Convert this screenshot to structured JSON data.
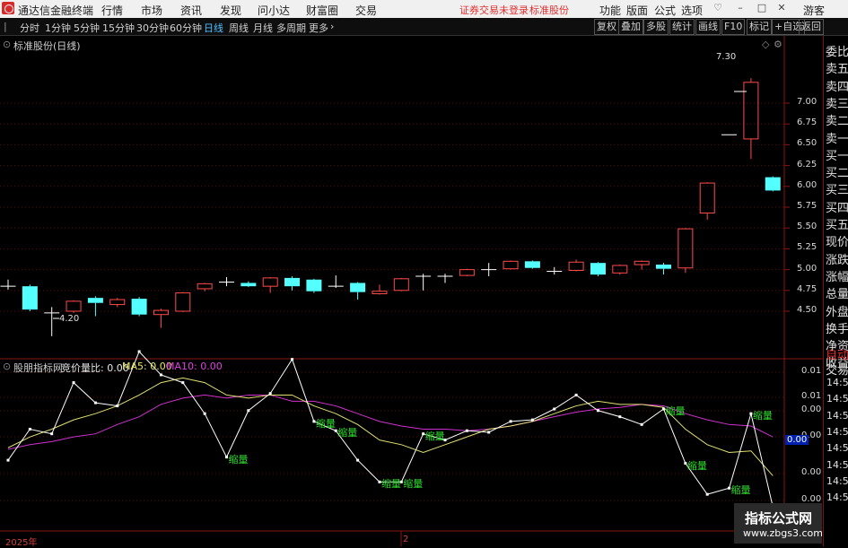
{
  "titlebar": {
    "app_name": "通达信金融终端",
    "menus": [
      "行情",
      "市场",
      "资讯",
      "发现",
      "问小达",
      "财富圈",
      "交易"
    ],
    "status_red": "证券交易未登录",
    "stock_red": "标准股份",
    "right_menus": [
      "功能",
      "版面",
      "公式",
      "选项"
    ],
    "guest": "游客"
  },
  "toolbar": {
    "periods": [
      "分时",
      "1分钟",
      "5分钟",
      "15分钟",
      "30分钟",
      "60分钟",
      "日线",
      "周线",
      "月线",
      "多周期",
      "更多"
    ],
    "selected": "日线",
    "buttons": [
      "复权",
      "叠加",
      "多股",
      "统计",
      "画线",
      "F10",
      "标记",
      "+自选",
      "返回"
    ]
  },
  "main_chart": {
    "title": "标准股份(日线)",
    "yticks": [
      "7.00",
      "6.75",
      "6.50",
      "6.25",
      "6.00",
      "5.75",
      "5.50",
      "5.25",
      "5.00",
      "4.75",
      "4.50"
    ],
    "high_label": "7.30",
    "low_label": "4.20"
  },
  "sub_chart": {
    "name": "股朋指标网",
    "indicator": "竞价量比: 0.00",
    "ma5": "MA5: 0.00",
    "ma10": "MA10: 0.00",
    "yticks": [
      "0.01",
      "0.01",
      "0.00",
      "0.00",
      "0.00",
      "0.00"
    ],
    "current": "0.00",
    "tag": "缩量"
  },
  "xaxis": {
    "year": "2025年",
    "mark": "2"
  },
  "right_panel": {
    "items": [
      "委比",
      "卖五",
      "卖四",
      "卖三",
      "卖二",
      "卖一",
      "买一",
      "买二",
      "买三",
      "买四",
      "买五",
      "现价",
      "涨跌",
      "涨幅",
      "总量",
      "外盘",
      "换手",
      "净资",
      "收益"
    ],
    "auto": "自动",
    "trade": "交易",
    "times": [
      "14:56",
      "14:56",
      "14:56",
      "14:56",
      "14:56",
      "14:56",
      "14:56",
      "14:56"
    ]
  },
  "watermark": {
    "line1": "指标公式网",
    "line2": "www.zbgs3.com"
  },
  "chart_data": {
    "type": "candlestick",
    "candles": [
      {
        "o": 4.8,
        "c": 4.8,
        "h": 4.88,
        "l": 4.76
      },
      {
        "o": 4.8,
        "c": 4.52,
        "h": 4.82,
        "l": 4.5
      },
      {
        "o": 4.48,
        "c": 4.48,
        "h": 4.55,
        "l": 4.2
      },
      {
        "o": 4.5,
        "c": 4.62,
        "h": 4.63,
        "l": 4.48
      },
      {
        "o": 4.66,
        "c": 4.6,
        "h": 4.68,
        "l": 4.44
      },
      {
        "o": 4.58,
        "c": 4.64,
        "h": 4.66,
        "l": 4.55
      },
      {
        "o": 4.65,
        "c": 4.46,
        "h": 4.67,
        "l": 4.44
      },
      {
        "o": 4.46,
        "c": 4.51,
        "h": 4.53,
        "l": 4.3
      },
      {
        "o": 4.5,
        "c": 4.72,
        "h": 4.73,
        "l": 4.49
      },
      {
        "o": 4.77,
        "c": 4.83,
        "h": 4.84,
        "l": 4.74
      },
      {
        "o": 4.85,
        "c": 4.85,
        "h": 4.91,
        "l": 4.8
      },
      {
        "o": 4.84,
        "c": 4.8,
        "h": 4.86,
        "l": 4.79
      },
      {
        "o": 4.8,
        "c": 4.9,
        "h": 4.91,
        "l": 4.72
      },
      {
        "o": 4.9,
        "c": 4.8,
        "h": 4.92,
        "l": 4.75
      },
      {
        "o": 4.88,
        "c": 4.74,
        "h": 4.89,
        "l": 4.72
      },
      {
        "o": 4.8,
        "c": 4.8,
        "h": 4.93,
        "l": 4.78
      },
      {
        "o": 4.84,
        "c": 4.73,
        "h": 4.85,
        "l": 4.64
      },
      {
        "o": 4.71,
        "c": 4.74,
        "h": 4.82,
        "l": 4.7
      },
      {
        "o": 4.75,
        "c": 4.89,
        "h": 4.9,
        "l": 4.74
      },
      {
        "o": 4.92,
        "c": 4.92,
        "h": 4.95,
        "l": 4.75
      },
      {
        "o": 4.92,
        "c": 4.92,
        "h": 4.95,
        "l": 4.84
      },
      {
        "o": 4.93,
        "c": 5.0,
        "h": 5.01,
        "l": 4.92
      },
      {
        "o": 5.0,
        "c": 5.0,
        "h": 5.08,
        "l": 4.92
      },
      {
        "o": 5.01,
        "c": 5.1,
        "h": 5.11,
        "l": 5.0
      },
      {
        "o": 5.1,
        "c": 5.02,
        "h": 5.11,
        "l": 5.01
      },
      {
        "o": 4.98,
        "c": 4.98,
        "h": 5.03,
        "l": 4.94
      },
      {
        "o": 4.99,
        "c": 5.09,
        "h": 5.12,
        "l": 4.98
      },
      {
        "o": 5.08,
        "c": 4.94,
        "h": 5.09,
        "l": 4.92
      },
      {
        "o": 4.96,
        "c": 5.05,
        "h": 5.06,
        "l": 4.94
      },
      {
        "o": 5.06,
        "c": 5.1,
        "h": 5.11,
        "l": 5.0
      },
      {
        "o": 5.06,
        "c": 5.01,
        "h": 5.08,
        "l": 4.94
      },
      {
        "o": 5.02,
        "c": 5.49,
        "h": 5.5,
        "l": 4.96
      },
      {
        "o": 5.68,
        "c": 6.04,
        "h": 6.05,
        "l": 5.6
      },
      {
        "o": 6.62,
        "c": 6.62,
        "h": 6.62,
        "l": 6.62
      },
      {
        "o": 6.57,
        "c": 7.25,
        "h": 7.3,
        "l": 6.33
      },
      {
        "o": 6.11,
        "c": 5.95,
        "h": 6.12,
        "l": 5.94
      }
    ],
    "white_line": [
      0.3,
      0.5,
      0.47,
      0.8,
      0.67,
      0.65,
      1.0,
      0.85,
      0.8,
      0.6,
      0.32,
      0.62,
      0.73,
      0.95,
      0.55,
      0.49,
      0.3,
      0.16,
      0.16,
      0.47,
      0.43,
      0.49,
      0.48,
      0.55,
      0.56,
      0.63,
      0.72,
      0.62,
      0.58,
      0.53,
      0.63,
      0.28,
      0.08,
      0.12,
      0.6,
      0.0
    ],
    "yellow_line": [
      0.38,
      0.45,
      0.5,
      0.56,
      0.6,
      0.65,
      0.72,
      0.8,
      0.83,
      0.8,
      0.72,
      0.7,
      0.72,
      0.72,
      0.65,
      0.6,
      0.53,
      0.43,
      0.4,
      0.35,
      0.4,
      0.45,
      0.5,
      0.52,
      0.55,
      0.6,
      0.65,
      0.68,
      0.66,
      0.66,
      0.64,
      0.5,
      0.4,
      0.35,
      0.36,
      0.2
    ],
    "magenta_line": [
      0.37,
      0.4,
      0.42,
      0.45,
      0.47,
      0.53,
      0.58,
      0.66,
      0.7,
      0.72,
      0.7,
      0.72,
      0.72,
      0.68,
      0.68,
      0.65,
      0.6,
      0.55,
      0.52,
      0.5,
      0.5,
      0.49,
      0.5,
      0.52,
      0.55,
      0.58,
      0.61,
      0.63,
      0.64,
      0.66,
      0.65,
      0.6,
      0.56,
      0.53,
      0.52,
      0.45
    ],
    "suoliang_at": [
      10,
      14,
      15,
      17,
      18,
      19,
      30,
      31,
      33,
      34
    ]
  }
}
